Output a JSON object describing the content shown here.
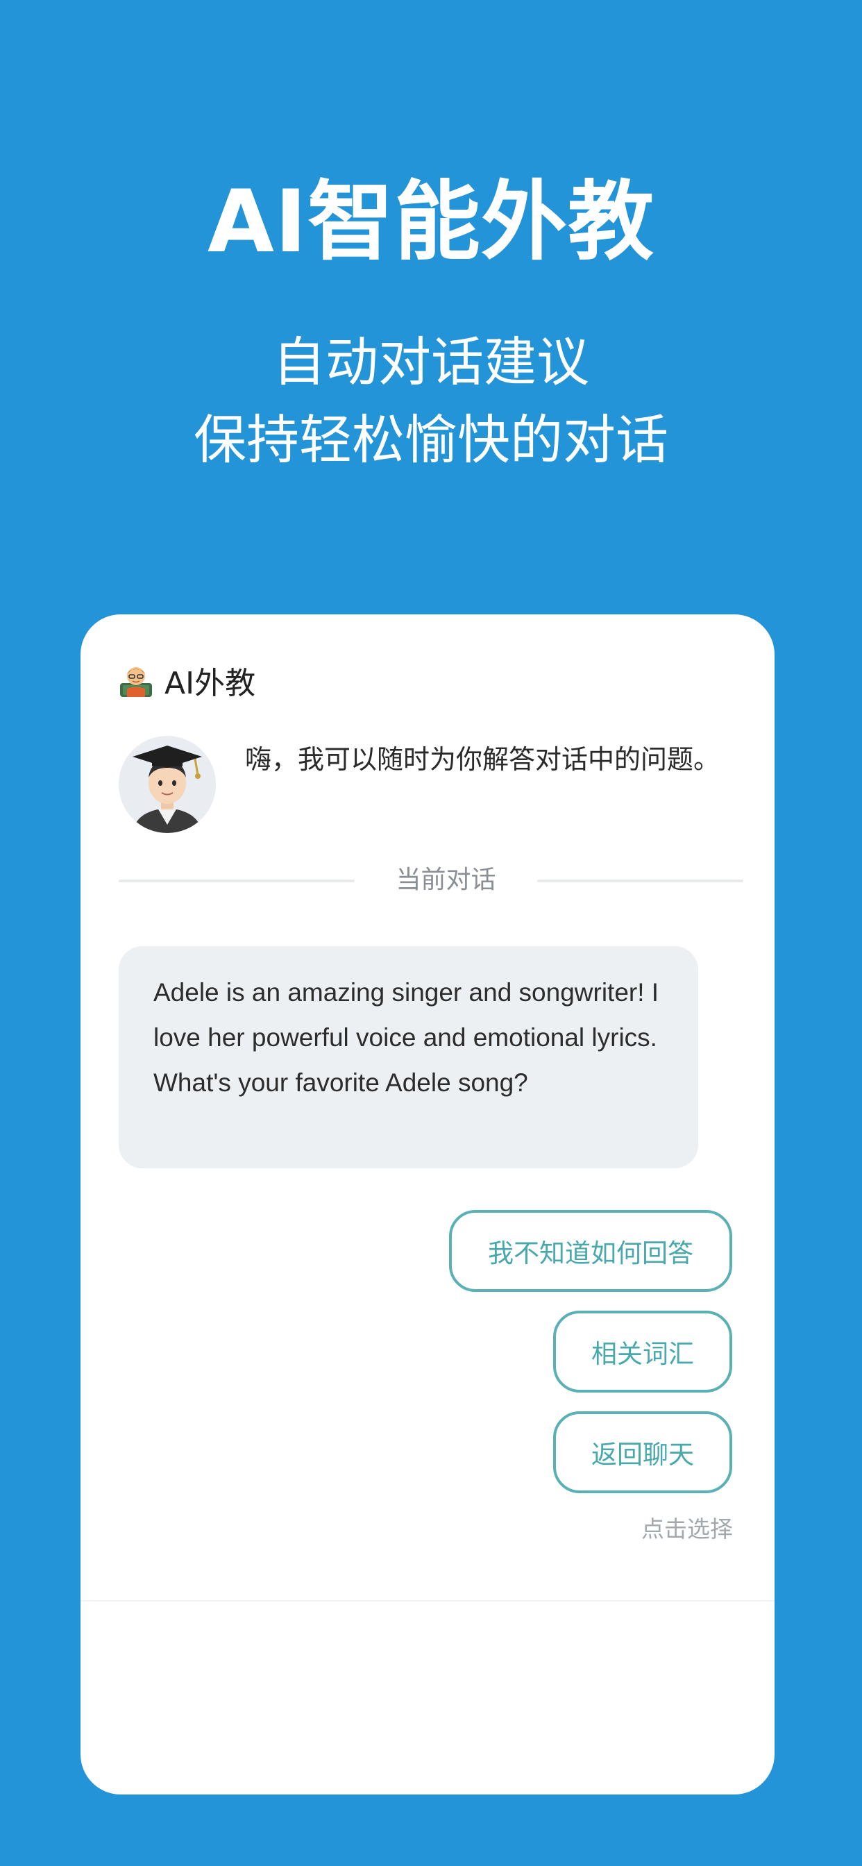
{
  "hero": {
    "title": "AI智能外教",
    "subtitle_line1": "自动对话建议",
    "subtitle_line2": "保持轻松愉快的对话"
  },
  "card": {
    "header_icon": "teacher-emoji-icon",
    "header_title": "AI外教",
    "avatar": "graduate-avatar",
    "greeting": "嗨，我可以随时为你解答对话中的问题。",
    "divider_label": "当前对话",
    "message": "Adele is an amazing singer and songwriter! I love her powerful voice and emotional lyrics. What's your favorite Adele song?",
    "options": [
      "我不知道如何回答",
      "相关词汇",
      "返回聊天"
    ],
    "hint": "点击选择"
  },
  "colors": {
    "background": "#2494d9",
    "card": "#ffffff",
    "chip_border": "#5ab0b4",
    "chip_text": "#48a8ac",
    "bubble": "#edf0f3"
  }
}
